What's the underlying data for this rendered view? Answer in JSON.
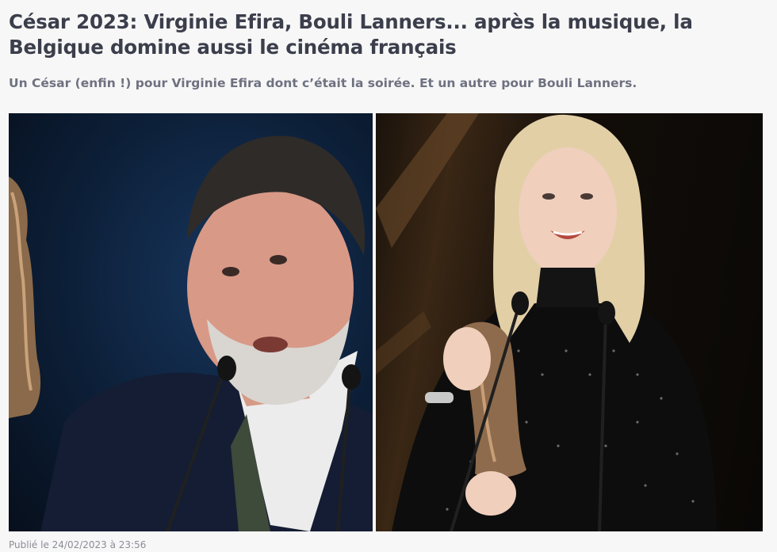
{
  "article": {
    "headline": "César 2023: Virginie Efira, Bouli Lanners... après la musique, la Belgique domine aussi le cinéma français",
    "subtitle": "Un César (enfin !) pour Virginie Efira dont c’était la soirée. Et un autre pour Bouli Lanners.",
    "published": "Publié le 24/02/2023 à 23:56"
  },
  "photos": {
    "left_icon": "man-with-cesar-trophy-at-microphone",
    "right_icon": "woman-with-cesar-trophy-at-microphone"
  },
  "colors": {
    "headline": "#3b3e4b",
    "subtitle": "#6e7180",
    "footer": "#8b8d96",
    "background": "#f7f7f7"
  }
}
